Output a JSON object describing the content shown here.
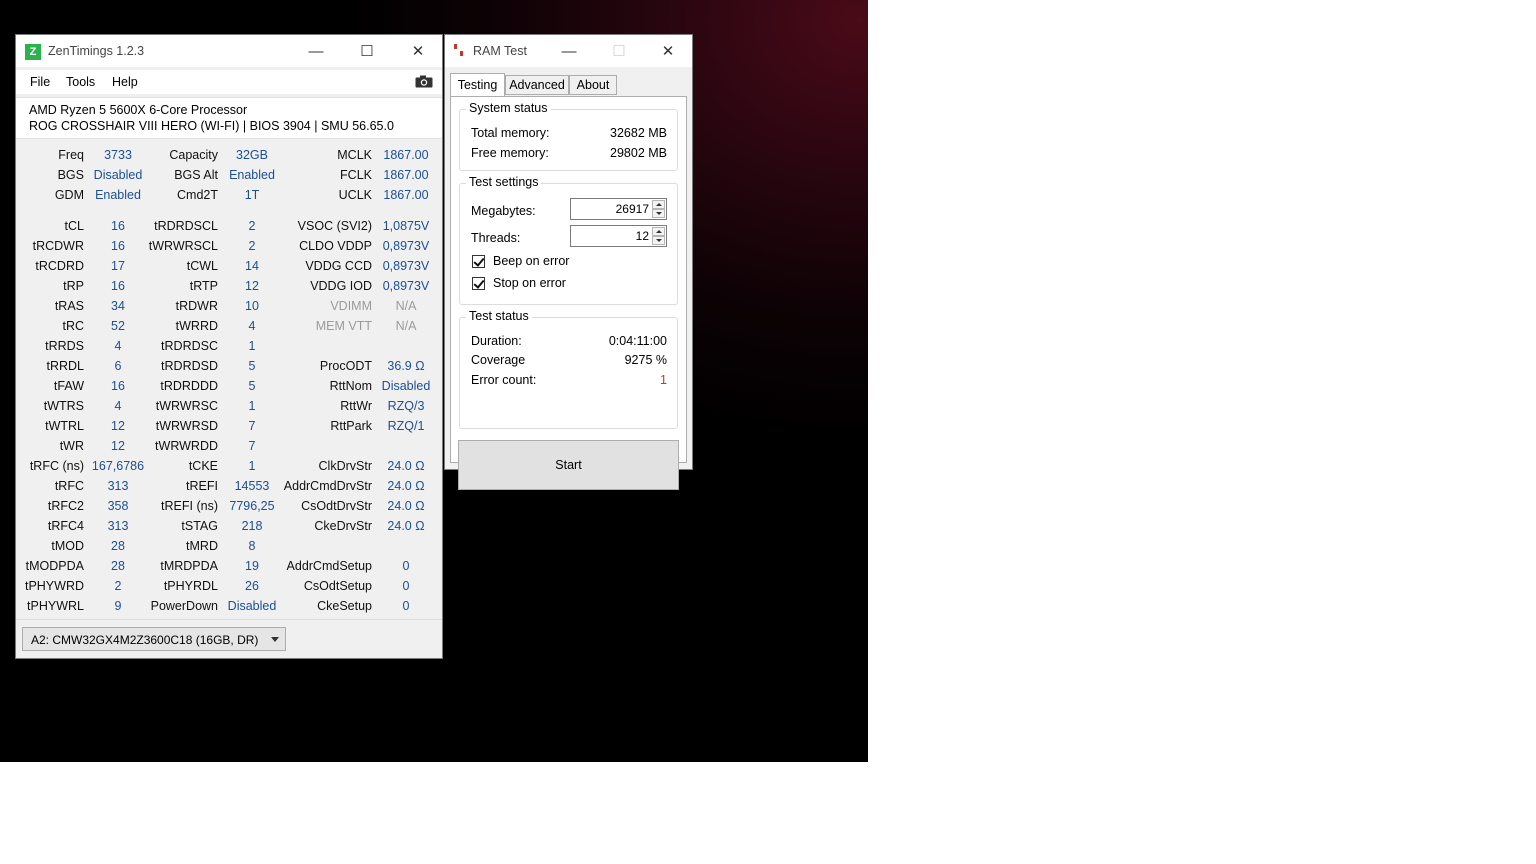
{
  "zentimings": {
    "title": "ZenTimings 1.2.3",
    "logo_letter": "Z",
    "menu": [
      "File",
      "Tools",
      "Help"
    ],
    "cpu": "AMD Ryzen 5 5600X 6-Core Processor",
    "board": "ROG CROSSHAIR VIII HERO (WI-FI) | BIOS 3904 | SMU 56.65.0",
    "rows_top": [
      [
        "Freq",
        "3733",
        "Capacity",
        "32GB",
        "MCLK",
        "1867.00"
      ],
      [
        "BGS",
        "Disabled",
        "BGS Alt",
        "Enabled",
        "FCLK",
        "1867.00"
      ],
      [
        "GDM",
        "Enabled",
        "Cmd2T",
        "1T",
        "UCLK",
        "1867.00"
      ]
    ],
    "rows": [
      [
        "tCL",
        "16",
        "tRDRDSCL",
        "2",
        "VSOC (SVI2)",
        "1,0875V"
      ],
      [
        "tRCDWR",
        "16",
        "tWRWRSCL",
        "2",
        "CLDO VDDP",
        "0,8973V"
      ],
      [
        "tRCDRD",
        "17",
        "tCWL",
        "14",
        "VDDG CCD",
        "0,8973V"
      ],
      [
        "tRP",
        "16",
        "tRTP",
        "12",
        "VDDG IOD",
        "0,8973V"
      ],
      [
        "tRAS",
        "34",
        "tRDWR",
        "10",
        "VDIMM",
        "N/A"
      ],
      [
        "tRC",
        "52",
        "tWRRD",
        "4",
        "MEM VTT",
        "N/A"
      ],
      [
        "tRRDS",
        "4",
        "tRDRDSC",
        "1",
        "",
        ""
      ],
      [
        "tRRDL",
        "6",
        "tRDRDSD",
        "5",
        "ProcODT",
        "36.9 Ω"
      ],
      [
        "tFAW",
        "16",
        "tRDRDDD",
        "5",
        "RttNom",
        "Disabled"
      ],
      [
        "tWTRS",
        "4",
        "tWRWRSC",
        "1",
        "RttWr",
        "RZQ/3"
      ],
      [
        "tWTRL",
        "12",
        "tWRWRSD",
        "7",
        "RttPark",
        "RZQ/1"
      ],
      [
        "tWR",
        "12",
        "tWRWRDD",
        "7",
        "",
        ""
      ],
      [
        "tRFC (ns)",
        "167,6786",
        "tCKE",
        "1",
        "ClkDrvStr",
        "24.0 Ω"
      ],
      [
        "tRFC",
        "313",
        "tREFI",
        "14553",
        "AddrCmdDrvStr",
        "24.0 Ω"
      ],
      [
        "tRFC2",
        "358",
        "tREFI (ns)",
        "7796,25",
        "CsOdtDrvStr",
        "24.0 Ω"
      ],
      [
        "tRFC4",
        "313",
        "tSTAG",
        "218",
        "CkeDrvStr",
        "24.0 Ω"
      ],
      [
        "tMOD",
        "28",
        "tMRD",
        "8",
        "",
        ""
      ],
      [
        "tMODPDA",
        "28",
        "tMRDPDA",
        "19",
        "AddrCmdSetup",
        "0"
      ],
      [
        "tPHYWRD",
        "2",
        "tPHYRDL",
        "26",
        "CsOdtSetup",
        "0"
      ],
      [
        "tPHYWRL",
        "9",
        "PowerDown",
        "Disabled",
        "CkeSetup",
        "0"
      ]
    ],
    "dimm_selected": "A2: CMW32GX4M2Z3600C18 (16GB, DR)"
  },
  "ramtest": {
    "title": "RAM Test",
    "tabs": [
      "Testing",
      "Advanced",
      "About"
    ],
    "system_status": {
      "title": "System status",
      "total_label": "Total memory:",
      "total_value": "32682 MB",
      "free_label": "Free memory:",
      "free_value": "29802 MB"
    },
    "test_settings": {
      "title": "Test settings",
      "megabytes_label": "Megabytes:",
      "megabytes_value": "26917",
      "threads_label": "Threads:",
      "threads_value": "12",
      "beep_label": "Beep on error",
      "stop_label": "Stop on error"
    },
    "test_status": {
      "title": "Test status",
      "duration_label": "Duration:",
      "duration_value": "0:04:11:00",
      "coverage_label": "Coverage",
      "coverage_value": "9275 %",
      "errors_label": "Error count:",
      "errors_value": "1"
    },
    "start_label": "Start"
  },
  "colors": {
    "value_blue": "#1d4f91",
    "error_red": "#c0392b",
    "zen_green": "#2bb24c"
  }
}
